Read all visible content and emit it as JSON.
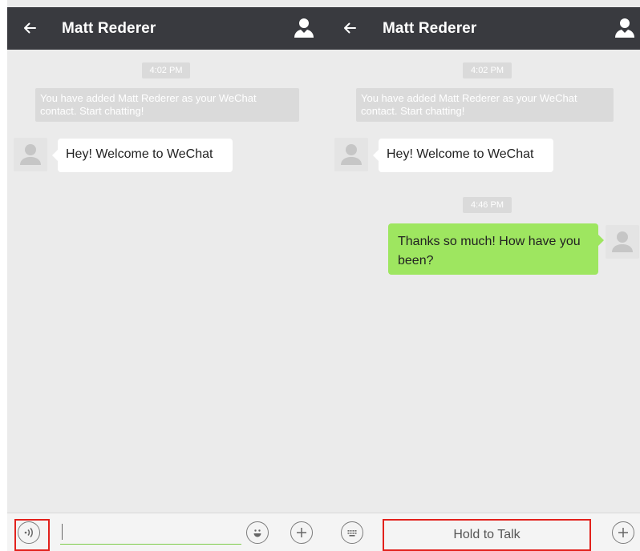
{
  "colors": {
    "header_bg": "#393a3f",
    "chat_bg": "#ebebeb",
    "outgoing_bubble": "#9ee660",
    "incoming_bubble": "#ffffff",
    "highlight_box": "#e2211c",
    "input_underline": "#7dcc4a"
  },
  "left_screen": {
    "header": {
      "back_icon": "arrow-left-icon",
      "title": "Matt Rederer",
      "profile_icon": "person-icon"
    },
    "timestamp": "4:02 PM",
    "system_message": "You have added Matt Rederer as your WeChat contact. Start chatting!",
    "messages": [
      {
        "from": "contact",
        "text": "Hey! Welcome to WeChat"
      }
    ],
    "input_bar": {
      "voice_icon": "voice-icon",
      "text_value": "",
      "emoji_icon": "emoji-icon",
      "plus_icon": "plus-icon"
    }
  },
  "right_screen": {
    "header": {
      "back_icon": "arrow-left-icon",
      "title": "Matt Rederer",
      "profile_icon": "person-icon"
    },
    "timestamp_1": "4:02 PM",
    "system_message": "You have added Matt Rederer as your WeChat contact. Start chatting!",
    "messages": [
      {
        "from": "contact",
        "text": "Hey! Welcome to WeChat"
      }
    ],
    "timestamp_2": "4:46 PM",
    "sent_message": {
      "from": "me",
      "text": "Thanks so much! How have you been?"
    },
    "input_bar": {
      "keyboard_icon": "keyboard-icon",
      "hold_to_talk_label": "Hold to Talk",
      "plus_icon": "plus-icon"
    }
  }
}
